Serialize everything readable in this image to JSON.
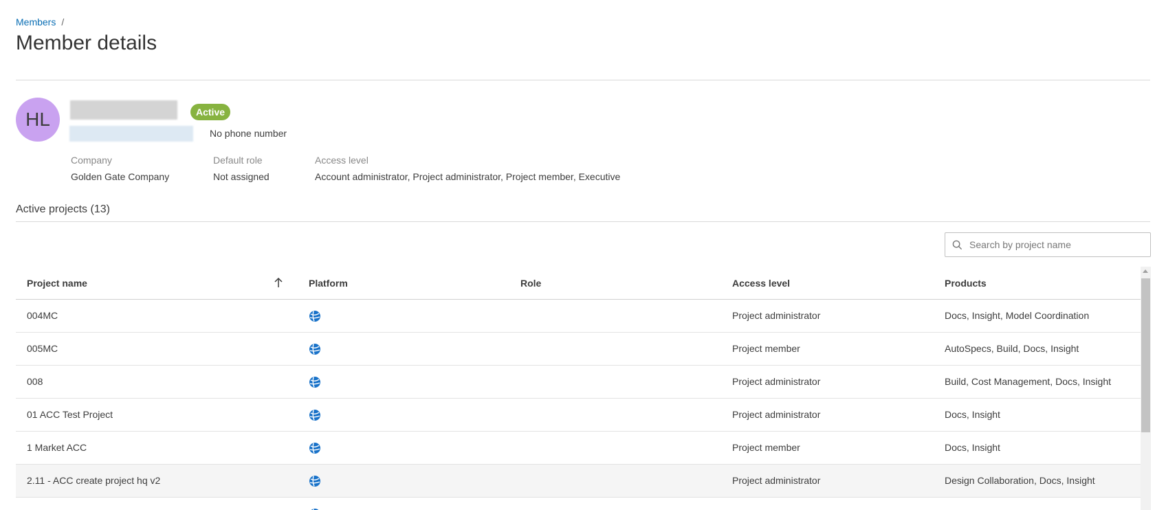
{
  "breadcrumb": {
    "parent": "Members",
    "separator": "/"
  },
  "page_title": "Member details",
  "member": {
    "initials": "HL",
    "status": "Active",
    "phone": "No phone number",
    "fields": [
      {
        "label": "Company",
        "value": "Golden Gate Company"
      },
      {
        "label": "Default role",
        "value": "Not assigned"
      },
      {
        "label": "Access level",
        "value": "Account administrator, Project administrator, Project member, Executive"
      }
    ]
  },
  "projects_section": {
    "title": "Active projects (13)"
  },
  "search": {
    "placeholder": "Search by project name",
    "value": ""
  },
  "table": {
    "columns": [
      "Project name",
      "Platform",
      "Role",
      "Access level",
      "Products"
    ],
    "sort_icon": "arrow-up-icon",
    "platform_icon": "globe-icon",
    "rows": [
      {
        "name": "004MC",
        "role": "",
        "access": "Project administrator",
        "products": "Docs, Insight, Model Coordination"
      },
      {
        "name": "005MC",
        "role": "",
        "access": "Project member",
        "products": "AutoSpecs, Build, Docs, Insight"
      },
      {
        "name": "008",
        "role": "",
        "access": "Project administrator",
        "products": "Build, Cost Management, Docs, Insight"
      },
      {
        "name": "01 ACC Test Project",
        "role": "",
        "access": "Project administrator",
        "products": "Docs, Insight"
      },
      {
        "name": "1 Market ACC",
        "role": "",
        "access": "Project member",
        "products": "Docs, Insight"
      },
      {
        "name": "2.11 - ACC create project hq v2",
        "role": "",
        "access": "Project administrator",
        "products": "Design Collaboration, Docs, Insight"
      }
    ]
  },
  "colors": {
    "accent": "#0a6eb4",
    "status_active": "#87b340",
    "avatar": "#c9a2f0"
  }
}
